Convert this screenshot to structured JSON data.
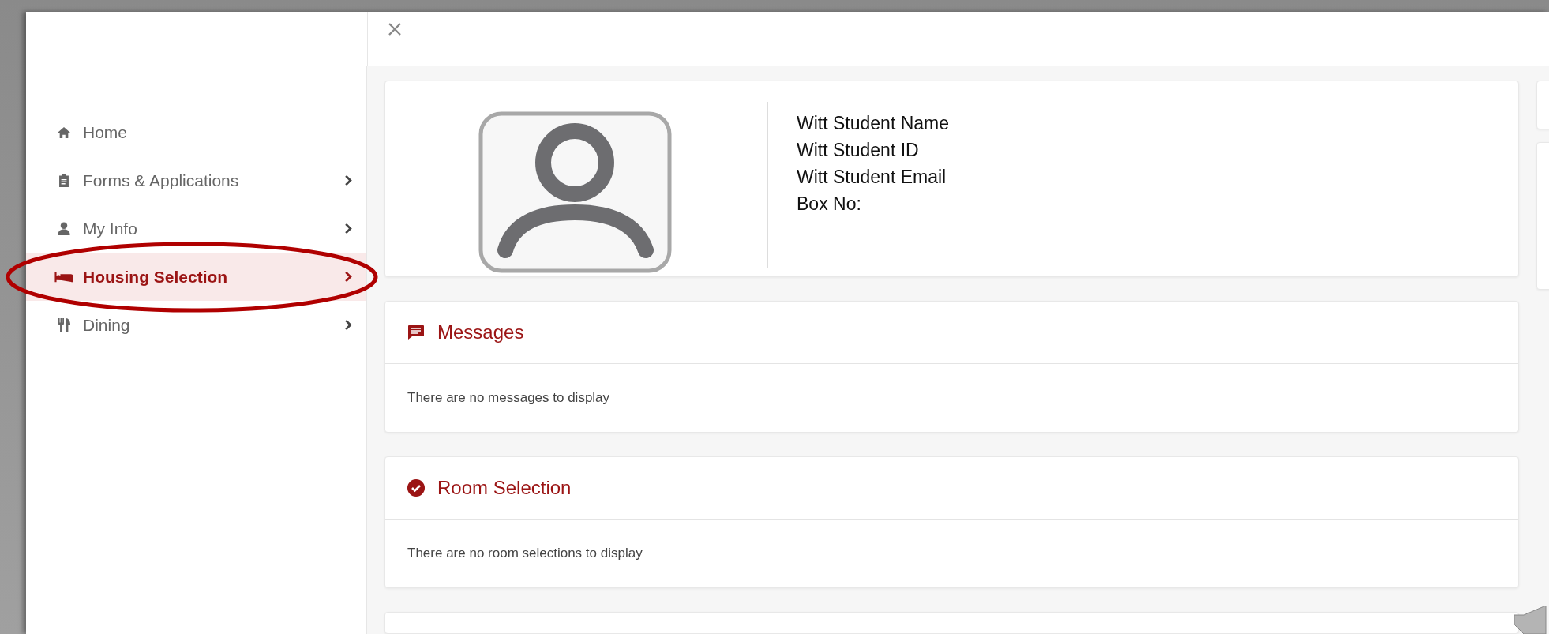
{
  "sidebar": {
    "items": [
      {
        "label": "Home",
        "kind": "home",
        "has_submenu": false,
        "selected": false,
        "circled": false
      },
      {
        "label": "Forms & Applications",
        "kind": "forms",
        "has_submenu": true,
        "selected": false,
        "circled": false
      },
      {
        "label": "My Info",
        "kind": "info",
        "has_submenu": true,
        "selected": false,
        "circled": false
      },
      {
        "label": "Housing Selection",
        "kind": "housing",
        "has_submenu": true,
        "selected": true,
        "circled": true
      },
      {
        "label": "Dining",
        "kind": "dining",
        "has_submenu": true,
        "selected": false,
        "circled": false
      }
    ]
  },
  "profile": {
    "lines": [
      "Witt Student Name",
      "Witt Student ID",
      "Witt Student Email",
      "Box No:"
    ]
  },
  "panels": [
    {
      "title": "Messages",
      "kind": "messages",
      "body": "There are no messages to display"
    },
    {
      "title": "Room Selection",
      "kind": "rooms",
      "body": "There are no room selections to display"
    }
  ]
}
